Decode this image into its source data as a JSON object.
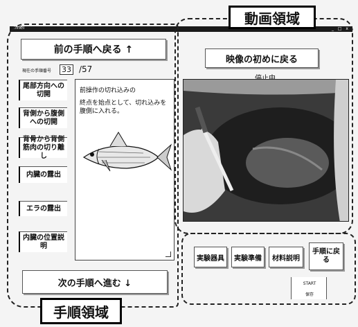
{
  "window": {
    "title": "Imei",
    "controls": "_ □ x"
  },
  "callouts": {
    "video_region": "動画領域",
    "procedure_region": "手順領域"
  },
  "nav": {
    "prev_step": "前の手順へ戻る ↑",
    "next_step": "次の手順へ進む ↓",
    "step_counter_label": "現在の手順番号",
    "step_current": "33",
    "step_total": "/57"
  },
  "steps": [
    "尾部方向への切開",
    "背側から腹側への切開",
    "背骨から背側筋肉の切り離し",
    "内臓の露出",
    "エラの露出",
    "内臓の位置説明"
  ],
  "instruction": {
    "title": "前操作の切れ込みの",
    "body": "終点を始点として、切れ込みを腹側に入れる。"
  },
  "video": {
    "restart_label": "映像の初めに戻る",
    "status": "停止中"
  },
  "toolbar": {
    "equipment": "実験器具",
    "preparation": "実験準備",
    "materials": "材料説明",
    "back_to_steps": "手順に戻る",
    "start": "START",
    "save": "保存"
  }
}
